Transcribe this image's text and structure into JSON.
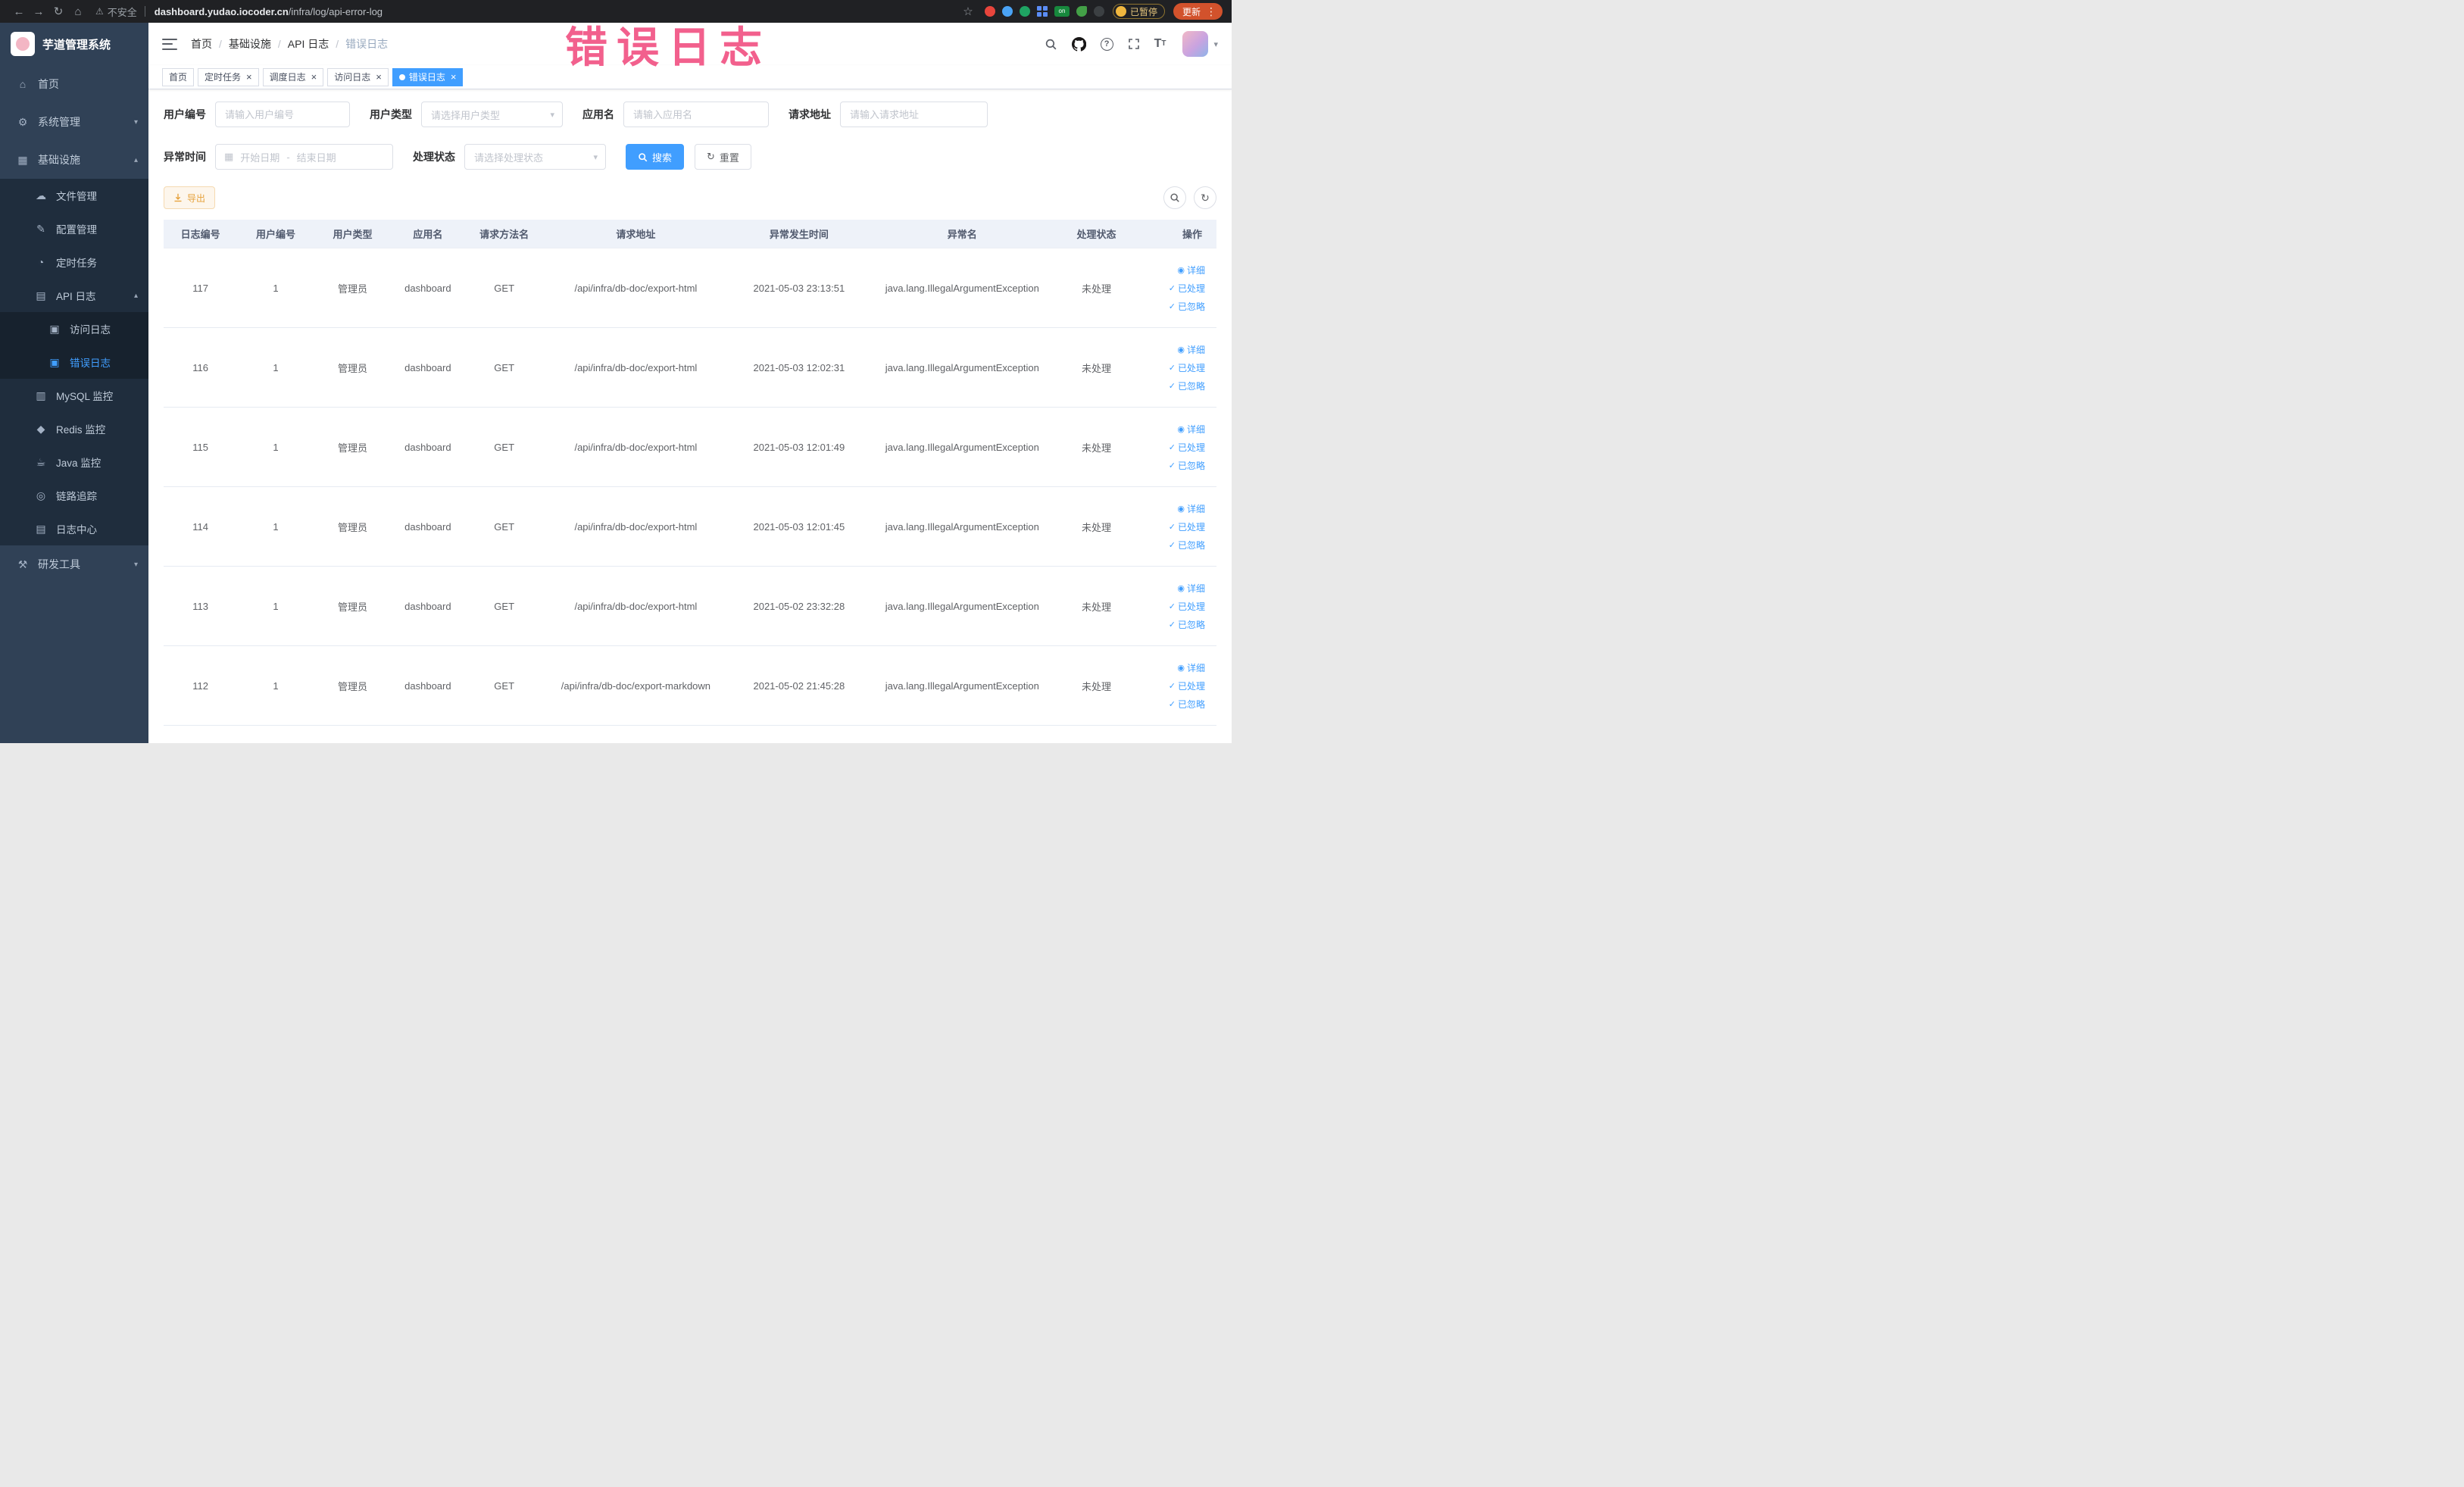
{
  "browser": {
    "security_label": "不安全",
    "url_domain": "dashboard.yudao.iocoder.cn",
    "url_path": "/infra/log/api-error-log",
    "extension_on_label": "on",
    "paused_badge": "已暂停",
    "update_button": "更新"
  },
  "annotation": {
    "title": "错误日志"
  },
  "sidebar": {
    "logo_title": "芋道管理系统",
    "items": [
      {
        "id": "home",
        "icon": "home",
        "label": "首页",
        "level": 1
      },
      {
        "id": "system",
        "icon": "gear",
        "label": "系统管理",
        "level": 1,
        "chevron": "down"
      },
      {
        "id": "infra",
        "icon": "grid",
        "label": "基础设施",
        "level": 1,
        "chevron": "up"
      },
      {
        "id": "file",
        "icon": "cloud",
        "label": "文件管理",
        "level": 2
      },
      {
        "id": "config",
        "icon": "edit",
        "label": "配置管理",
        "level": 2
      },
      {
        "id": "job",
        "icon": "clock",
        "label": "定时任务",
        "level": 2
      },
      {
        "id": "api-log",
        "icon": "doc",
        "label": "API 日志",
        "level": 2,
        "chevron": "up"
      },
      {
        "id": "access-log",
        "icon": "doc2",
        "label": "访问日志",
        "level": 3
      },
      {
        "id": "error-log",
        "icon": "doc2",
        "label": "错误日志",
        "level": 3,
        "active": true
      },
      {
        "id": "mysql",
        "icon": "db",
        "label": "MySQL 监控",
        "level": 2
      },
      {
        "id": "redis",
        "icon": "diamond",
        "label": "Redis 监控",
        "level": 2
      },
      {
        "id": "java",
        "icon": "coffee",
        "label": "Java 监控",
        "level": 2
      },
      {
        "id": "trace",
        "icon": "eye",
        "label": "链路追踪",
        "level": 2
      },
      {
        "id": "log-center",
        "icon": "list",
        "label": "日志中心",
        "level": 2
      },
      {
        "id": "devtools",
        "icon": "tools",
        "label": "研发工具",
        "level": 1,
        "chevron": "down"
      }
    ]
  },
  "header": {
    "breadcrumb": [
      {
        "label": "首页"
      },
      {
        "label": "基础设施"
      },
      {
        "label": "API 日志"
      },
      {
        "label": "错误日志",
        "current": true
      }
    ]
  },
  "tabs": [
    {
      "id": "home",
      "label": "首页",
      "closable": false
    },
    {
      "id": "scheduled-job",
      "label": "定时任务",
      "closable": true
    },
    {
      "id": "job-log",
      "label": "调度日志",
      "closable": true
    },
    {
      "id": "access-log",
      "label": "访问日志",
      "closable": true
    },
    {
      "id": "error-log",
      "label": "错误日志",
      "closable": true,
      "active": true
    }
  ],
  "filters": {
    "user_id": {
      "label": "用户编号",
      "placeholder": "请输入用户编号"
    },
    "user_type": {
      "label": "用户类型",
      "placeholder": "请选择用户类型"
    },
    "app_name": {
      "label": "应用名",
      "placeholder": "请输入应用名"
    },
    "request_url": {
      "label": "请求地址",
      "placeholder": "请输入请求地址"
    },
    "exception_time": {
      "label": "异常时间",
      "start_placeholder": "开始日期",
      "separator": "-",
      "end_placeholder": "结束日期"
    },
    "process_status": {
      "label": "处理状态",
      "placeholder": "请选择处理状态"
    },
    "search_button": "搜索",
    "reset_button": "重置"
  },
  "toolbar": {
    "export_button": "导出"
  },
  "table": {
    "columns": [
      "日志编号",
      "用户编号",
      "用户类型",
      "应用名",
      "请求方法名",
      "请求地址",
      "异常发生时间",
      "异常名",
      "处理状态",
      "操作"
    ],
    "col_ids": [
      "log-id",
      "user-id",
      "user-type",
      "app-name",
      "method",
      "url",
      "time",
      "exception",
      "status"
    ],
    "row_actions": [
      {
        "id": "detail",
        "label": "详细",
        "icon": "eye"
      },
      {
        "id": "processed",
        "label": "已处理",
        "icon": "check"
      },
      {
        "id": "ignored",
        "label": "已忽略",
        "icon": "check"
      }
    ],
    "rows": [
      {
        "cells": [
          "117",
          "1",
          "管理员",
          "dashboard",
          "GET",
          "/api/infra/db-doc/export-html",
          "2021-05-03 23:13:51",
          "java.lang.IllegalArgumentException",
          "未处理"
        ]
      },
      {
        "cells": [
          "116",
          "1",
          "管理员",
          "dashboard",
          "GET",
          "/api/infra/db-doc/export-html",
          "2021-05-03 12:02:31",
          "java.lang.IllegalArgumentException",
          "未处理"
        ]
      },
      {
        "cells": [
          "115",
          "1",
          "管理员",
          "dashboard",
          "GET",
          "/api/infra/db-doc/export-html",
          "2021-05-03 12:01:49",
          "java.lang.IllegalArgumentException",
          "未处理"
        ]
      },
      {
        "cells": [
          "114",
          "1",
          "管理员",
          "dashboard",
          "GET",
          "/api/infra/db-doc/export-html",
          "2021-05-03 12:01:45",
          "java.lang.IllegalArgumentException",
          "未处理"
        ]
      },
      {
        "cells": [
          "113",
          "1",
          "管理员",
          "dashboard",
          "GET",
          "/api/infra/db-doc/export-html",
          "2021-05-02 23:32:28",
          "java.lang.IllegalArgumentException",
          "未处理"
        ]
      },
      {
        "cells": [
          "112",
          "1",
          "管理员",
          "dashboard",
          "GET",
          "/api/infra/db-doc/export-markdown",
          "2021-05-02 21:45:28",
          "java.lang.IllegalArgumentException",
          "未处理"
        ]
      }
    ]
  }
}
